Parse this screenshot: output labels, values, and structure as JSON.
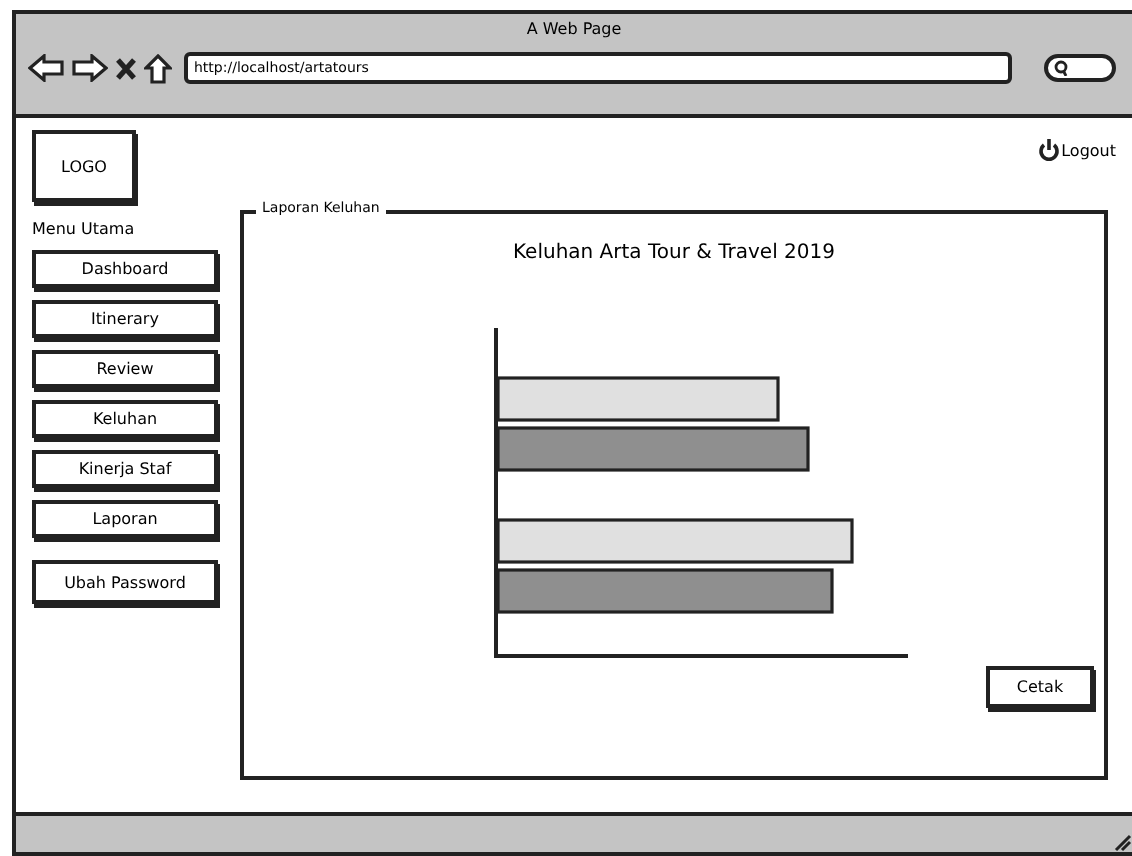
{
  "window": {
    "title": "A Web Page",
    "url": "http://localhost/artatours"
  },
  "header": {
    "logo": "LOGO",
    "logout": "Logout"
  },
  "menu": {
    "title": "Menu Utama",
    "items": [
      {
        "label": "Dashboard"
      },
      {
        "label": "Itinerary"
      },
      {
        "label": "Review"
      },
      {
        "label": "Keluhan"
      },
      {
        "label": "Kinerja Staf"
      },
      {
        "label": "Laporan"
      },
      {
        "label": "Ubah Password"
      }
    ]
  },
  "report": {
    "legend": "Laporan Keluhan",
    "chart_title": "Keluhan Arta Tour & Travel 2019",
    "print_button": "Cetak"
  }
}
